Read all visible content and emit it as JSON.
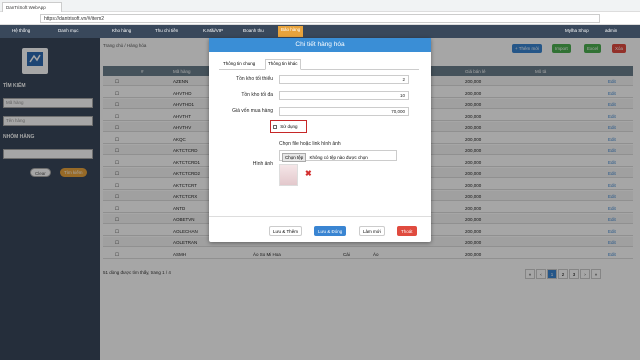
{
  "browser": {
    "tabs": [
      "DanTriSoft WebApp",
      "",
      "",
      "",
      "",
      "",
      "",
      ""
    ],
    "address": "https://dantrisoft.vn/#/item2"
  },
  "navbar": {
    "items": [
      "Hệ thống",
      "Danh mục",
      "Kho hàng",
      "Thu chi tiền",
      "K.Mãi/VIP",
      "Đoanh thu",
      "Bảo hàng"
    ],
    "right_items": [
      "Mylha Shop",
      "admin"
    ]
  },
  "sidebar": {
    "section_search": "TÌM KIẾM",
    "code_placeholder": "Mã hàng",
    "name_placeholder": "Tên hàng",
    "section_group": "NHÓM HÀNG",
    "clear_label": "Clear",
    "search_label": "Tìm kiếm"
  },
  "main": {
    "breadcrumb": "Trang chủ  /  Hàng hóa",
    "buttons": {
      "add": "+ Thêm mới",
      "import": "Import",
      "export": "Excel",
      "delete": "Xóa"
    },
    "table": {
      "headers": [
        "#",
        "Mã hàng",
        "Giá bán lẻ",
        "Mô tả"
      ],
      "rows": [
        {
          "code": "AZENN",
          "price": "200,000",
          "edit": "Edit"
        },
        {
          "code": "AHVTHD",
          "price": "200,000",
          "edit": "Edit"
        },
        {
          "code": "AHVTHD1",
          "price": "200,000",
          "edit": "Edit"
        },
        {
          "code": "AHVTHT",
          "price": "200,000",
          "edit": "Edit"
        },
        {
          "code": "AHVTHV",
          "price": "200,000",
          "edit": "Edit"
        },
        {
          "code": "AKQC",
          "price": "200,000",
          "edit": "Edit"
        },
        {
          "code": "AKTCTCRD",
          "price": "200,000",
          "edit": "Edit"
        },
        {
          "code": "AKTCTCRD1",
          "price": "200,000",
          "edit": "Edit"
        },
        {
          "code": "AKTCTCRD2",
          "price": "200,000",
          "edit": "Edit"
        },
        {
          "code": "AKTCTCRT",
          "price": "200,000",
          "edit": "Edit"
        },
        {
          "code": "AKTCTCRX",
          "price": "200,000",
          "edit": "Edit"
        },
        {
          "code": "ANTD",
          "price": "200,000",
          "edit": "Edit"
        },
        {
          "code": "AOBETVN",
          "price": "200,000",
          "edit": "Edit"
        },
        {
          "code": "AOLECHAN",
          "price": "200,000",
          "edit": "Edit"
        },
        {
          "code": "AOLETRAN",
          "price": "200,000",
          "edit": "Edit"
        },
        {
          "code": "ASMH",
          "name": "Áo So Mi Hoa",
          "cat": "Cái",
          "group": "Áo",
          "price": "200,000",
          "edit": "Edit"
        }
      ]
    },
    "footer": "51 dòng được tìm thấy, trang 1 / 4",
    "pager": [
      "«",
      "‹",
      "1",
      "2",
      "3",
      "›",
      "»"
    ]
  },
  "modal": {
    "title": "Chi tiết hàng hóa",
    "tabs": [
      "Thông tin chung",
      "Thông tin khác"
    ],
    "fields": [
      {
        "label": "Tồn kho tối thiểu",
        "value": "2"
      },
      {
        "label": "Tồn kho tối đa",
        "value": "10"
      },
      {
        "label": "Giá vốn mua hàng",
        "value": "70,000"
      }
    ],
    "checkbox_label": "Sử dụng",
    "upload_title": "Chọn file hoặc link hình ảnh",
    "image_label": "Hình ảnh",
    "choose_file": "Chọn tệp",
    "no_file": "Không có tệp nào được chọn",
    "buttons": [
      "Lưu & Thêm",
      "Lưu & Đóng",
      "Làm mới",
      "Thoát"
    ]
  }
}
